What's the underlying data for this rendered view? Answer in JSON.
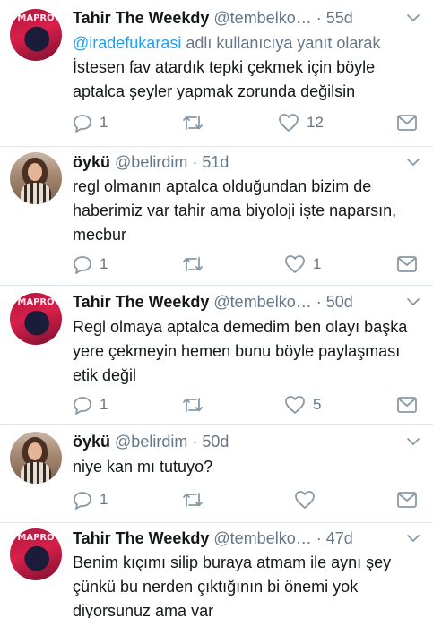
{
  "colors": {
    "text": "#14171a",
    "secondary": "#657786",
    "link": "#1da1f2",
    "divider": "#e1e8ed"
  },
  "tweets": [
    {
      "name": "Tahir The Weekdy",
      "handle": "@tembelko…",
      "sep": "·",
      "time": "55d",
      "avatar_icon": "avatar-tahir",
      "avatar_text": "MAPRO",
      "reply_mention": "@iradefukarasi",
      "reply_suffix": " adlı kullanıcıya yanıt olarak",
      "text": "İstesen fav atardık tepki çekmek için böyle aptalca şeyler yapmak zorunda değilsin",
      "replies": "1",
      "retweets": "",
      "likes": "12"
    },
    {
      "name": "öykü",
      "handle": "@belirdim",
      "sep": "·",
      "time": "51d",
      "avatar_icon": "avatar-oyku",
      "text": "regl olmanın aptalca olduğundan bizim de haberimiz var tahir ama biyoloji işte naparsın, mecbur",
      "replies": "1",
      "retweets": "",
      "likes": "1"
    },
    {
      "name": "Tahir The Weekdy",
      "handle": "@tembelko…",
      "sep": "·",
      "time": "50d",
      "avatar_icon": "avatar-tahir",
      "avatar_text": "MAPRO",
      "text": "Regl olmaya aptalca demedim ben olayı başka yere çekmeyin hemen bunu böyle paylaşması etik değil",
      "replies": "1",
      "retweets": "",
      "likes": "5"
    },
    {
      "name": "öykü",
      "handle": "@belirdim",
      "sep": "·",
      "time": "50d",
      "avatar_icon": "avatar-oyku",
      "text": "niye kan mı tutuyo?",
      "replies": "1",
      "retweets": "",
      "likes": ""
    },
    {
      "name": "Tahir The Weekdy",
      "handle": "@tembelko…",
      "sep": "·",
      "time": "47d",
      "avatar_icon": "avatar-tahir",
      "avatar_text": "MAPRO",
      "text": "Benim kıçımı silip buraya atmam ile aynı şey çünkü bu nerden çıktığının bi önemi yok diyorsunuz ama var"
    }
  ]
}
